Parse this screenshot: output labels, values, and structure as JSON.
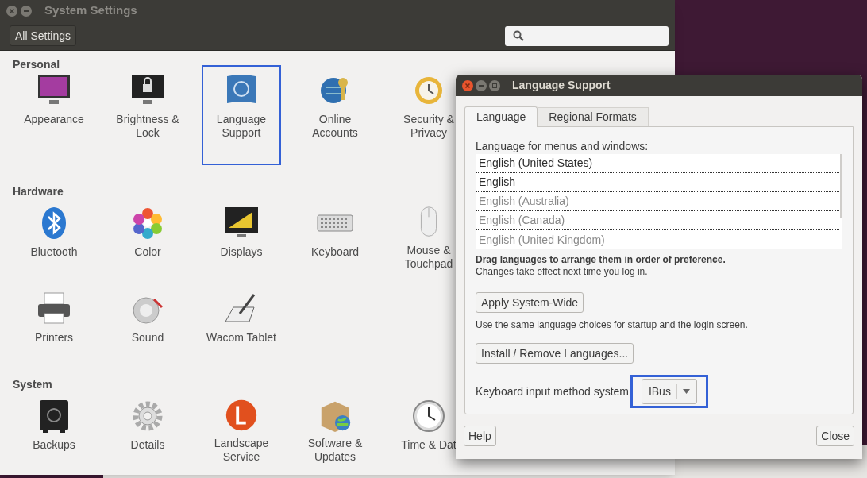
{
  "settings_window": {
    "title": "System Settings",
    "all_settings_button": "All Settings",
    "sections": [
      {
        "title": "Personal",
        "rows": [
          [
            {
              "label": [
                "Appearance"
              ],
              "highlighted": false
            },
            {
              "label": [
                "Brightness &",
                "Lock"
              ],
              "highlighted": false
            },
            {
              "label": [
                "Language",
                "Support"
              ],
              "highlighted": true
            },
            {
              "label": [
                "Online",
                "Accounts"
              ],
              "highlighted": false
            },
            {
              "label": [
                "Security &",
                "Privacy"
              ],
              "highlighted": false
            }
          ]
        ]
      },
      {
        "title": "Hardware",
        "rows": [
          [
            {
              "label": [
                "Bluetooth"
              ],
              "highlighted": false
            },
            {
              "label": [
                "Color"
              ],
              "highlighted": false
            },
            {
              "label": [
                "Displays"
              ],
              "highlighted": false
            },
            {
              "label": [
                "Keyboard"
              ],
              "highlighted": false
            },
            {
              "label": [
                "Mouse &",
                "Touchpad"
              ],
              "highlighted": false
            }
          ],
          [
            {
              "label": [
                "Printers"
              ],
              "highlighted": false
            },
            {
              "label": [
                "Sound"
              ],
              "highlighted": false
            },
            {
              "label": [
                "Wacom Tablet"
              ],
              "highlighted": false
            }
          ]
        ]
      },
      {
        "title": "System",
        "rows": [
          [
            {
              "label": [
                "Backups"
              ],
              "highlighted": false
            },
            {
              "label": [
                "Details"
              ],
              "highlighted": false
            },
            {
              "label": [
                "Landscape",
                "Service"
              ],
              "highlighted": false
            },
            {
              "label": [
                "Software &",
                "Updates"
              ],
              "highlighted": false
            },
            {
              "label": [
                "Time & Dat"
              ],
              "highlighted": false
            }
          ]
        ]
      }
    ]
  },
  "dialog": {
    "title": "Language Support",
    "tabs": [
      {
        "label": "Language",
        "selected": true
      },
      {
        "label": "Regional Formats",
        "selected": false
      }
    ],
    "list_label": "Language for menus and windows:",
    "languages": [
      {
        "name": "English (United States)",
        "disabled": false
      },
      {
        "name": "English",
        "disabled": false
      },
      {
        "name": "English (Australia)",
        "disabled": true
      },
      {
        "name": "English (Canada)",
        "disabled": true
      },
      {
        "name": "English (United Kingdom)",
        "disabled": true
      }
    ],
    "hint": "Drag languages to arrange them in order of preference.",
    "note": "Changes take effect next time you log in.",
    "apply_button": "Apply System-Wide",
    "apply_note": "Use the same language choices for startup and the login screen.",
    "install_button": "Install / Remove Languages...",
    "input_method_label": "Keyboard input method system:",
    "input_method": {
      "value": "IBus",
      "highlighted": true
    },
    "help_button": "Help",
    "close_button": "Close"
  }
}
